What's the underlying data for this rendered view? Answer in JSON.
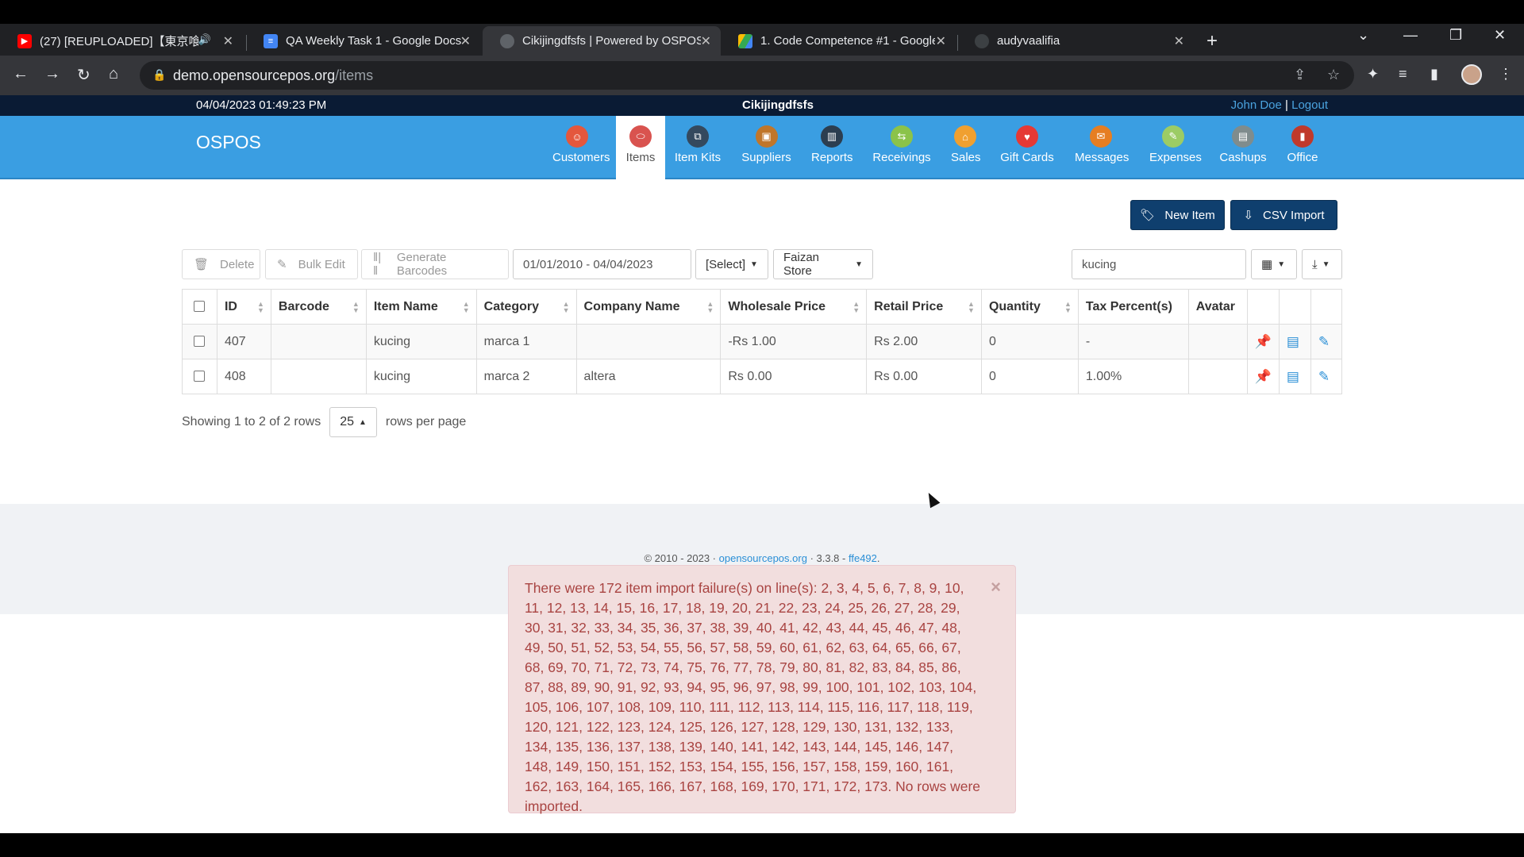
{
  "browser": {
    "tabs": [
      {
        "title": "(27) [REUPLOADED]【東京喰",
        "icon": "youtube-icon",
        "color": "#ff0000"
      },
      {
        "title": "QA Weekly Task 1 - Google Docs",
        "icon": "docs-icon",
        "color": "#4285f4"
      },
      {
        "title": "Cikijingdfsfs | Powered by OSPOS",
        "icon": "ospos-icon",
        "color": "#555555"
      },
      {
        "title": "1. Code Competence #1 - Google",
        "icon": "drive-icon",
        "color": "#34a853"
      },
      {
        "title": "audyvaalifia",
        "icon": "github-icon",
        "color": "#888888"
      }
    ],
    "url_host": "demo.opensourcepos.org",
    "url_path": "/items"
  },
  "header": {
    "datetime": "04/04/2023 01:49:23 PM",
    "store_name": "Cikijingdfsfs",
    "user": "John Doe",
    "separator": "|",
    "logout": "Logout"
  },
  "navbar": {
    "brand": "OSPOS",
    "modules": [
      {
        "label": "Customers",
        "color": "#e4573d"
      },
      {
        "label": "Items",
        "color": "#d9534f"
      },
      {
        "label": "Item Kits",
        "color": "#34495e"
      },
      {
        "label": "Suppliers",
        "color": "#c0762a"
      },
      {
        "label": "Reports",
        "color": "#2c3e50"
      },
      {
        "label": "Receivings",
        "color": "#8bc34a"
      },
      {
        "label": "Sales",
        "color": "#f0a030"
      },
      {
        "label": "Gift Cards",
        "color": "#e53935"
      },
      {
        "label": "Messages",
        "color": "#e67e22"
      },
      {
        "label": "Expenses",
        "color": "#9ccc65"
      },
      {
        "label": "Cashups",
        "color": "#7f8c8d"
      },
      {
        "label": "Office",
        "color": "#c0392b"
      }
    ],
    "active": "Items"
  },
  "actions": {
    "new_item": "New Item",
    "csv_import": "CSV Import"
  },
  "toolbar": {
    "delete": "Delete",
    "bulk_edit": "Bulk Edit",
    "generate_barcodes": "Generate Barcodes",
    "date_range": "01/01/2010 - 04/04/2023",
    "filter_select": "[Select]",
    "store_select": "Faizan Store",
    "search_value": "kucing"
  },
  "table": {
    "columns": [
      "ID",
      "Barcode",
      "Item Name",
      "Category",
      "Company Name",
      "Wholesale Price",
      "Retail Price",
      "Quantity",
      "Tax Percent(s)",
      "Avatar"
    ],
    "rows": [
      {
        "id": "407",
        "barcode": "",
        "name": "kucing",
        "category": "marca 1",
        "company": "",
        "wholesale": "-Rs 1.00",
        "retail": "Rs 2.00",
        "quantity": "0",
        "tax": "-",
        "avatar": ""
      },
      {
        "id": "408",
        "barcode": "",
        "name": "kucing",
        "category": "marca 2",
        "company": "altera",
        "wholesale": "Rs 0.00",
        "retail": "Rs 0.00",
        "quantity": "0",
        "tax": "1.00%",
        "avatar": ""
      }
    ]
  },
  "pagination": {
    "showing": "Showing 1 to 2 of 2 rows",
    "page_size": "25",
    "suffix": "rows per page"
  },
  "footer": {
    "prefix": "© 2010 - 2023 ·",
    "link": "opensourcepos.org",
    "version": "· 3.3.8 -",
    "commit": "ffe492",
    "end": "."
  },
  "alert": {
    "message": "There were 172 item import failure(s) on line(s): 2, 3, 4, 5, 6, 7, 8, 9, 10, 11, 12, 13, 14, 15, 16, 17, 18, 19, 20, 21, 22, 23, 24, 25, 26, 27, 28, 29, 30, 31, 32, 33, 34, 35, 36, 37, 38, 39, 40, 41, 42, 43, 44, 45, 46, 47, 48, 49, 50, 51, 52, 53, 54, 55, 56, 57, 58, 59, 60, 61, 62, 63, 64, 65, 66, 67, 68, 69, 70, 71, 72, 73, 74, 75, 76, 77, 78, 79, 80, 81, 82, 83, 84, 85, 86, 87, 88, 89, 90, 91, 92, 93, 94, 95, 96, 97, 98, 99, 100, 101, 102, 103, 104, 105, 106, 107, 108, 109, 110, 111, 112, 113, 114, 115, 116, 117, 118, 119, 120, 121, 122, 123, 124, 125, 126, 127, 128, 129, 130, 131, 132, 133, 134, 135, 136, 137, 138, 139, 140, 141, 142, 143, 144, 145, 146, 147, 148, 149, 150, 151, 152, 153, 154, 155, 156, 157, 158, 159, 160, 161, 162, 163, 164, 165, 166, 167, 168, 169, 170, 171, 172, 173. No rows were imported.",
    "close": "×"
  }
}
